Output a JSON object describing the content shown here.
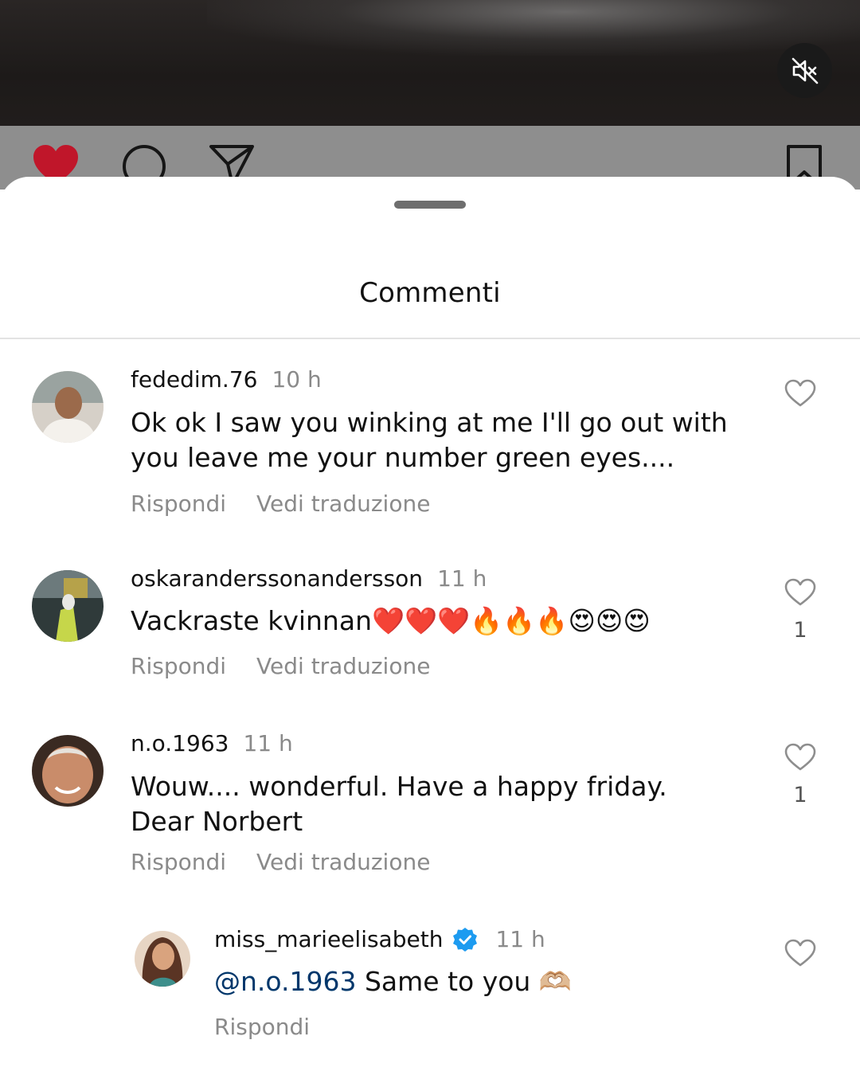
{
  "header": {
    "mute_button": "muted-speaker-icon"
  },
  "post_actions": {
    "like": "heart-filled-icon",
    "comment": "comment-bubble-icon",
    "share": "paper-plane-icon",
    "save": "bookmark-icon",
    "like_color": "#e0192b"
  },
  "sheet": {
    "title": "Commenti"
  },
  "comments": [
    {
      "username": "fededim.76",
      "time": "10 h",
      "text": "Ok ok I saw you winking at me I'll go out with you leave me your number green eyes....",
      "reply_label": "Rispondi",
      "translate_label": "Vedi traduzione",
      "likes": ""
    },
    {
      "username": "oskaranderssonandersson",
      "time": "11 h",
      "text": "Vackraste kvinnan❤️❤️❤️🔥🔥🔥😍😍😍",
      "reply_label": "Rispondi",
      "translate_label": "Vedi traduzione",
      "likes": "1"
    },
    {
      "username": "n.o.1963",
      "time": "11 h",
      "text": "Wouw.... wonderful. Have a happy friday.  Dear Norbert",
      "reply_label": "Rispondi",
      "translate_label": "Vedi traduzione",
      "likes": "1"
    }
  ],
  "reply": {
    "username": "miss_marieelisabeth",
    "verified": true,
    "time": "11 h",
    "mention": "@n.o.1963",
    "text": " Same to you 🫶🏼",
    "reply_label": "Rispondi",
    "likes": ""
  },
  "colors": {
    "mention": "#00376b",
    "verified_badge": "#1d9bf0",
    "secondary_text": "#8a8a8a"
  }
}
